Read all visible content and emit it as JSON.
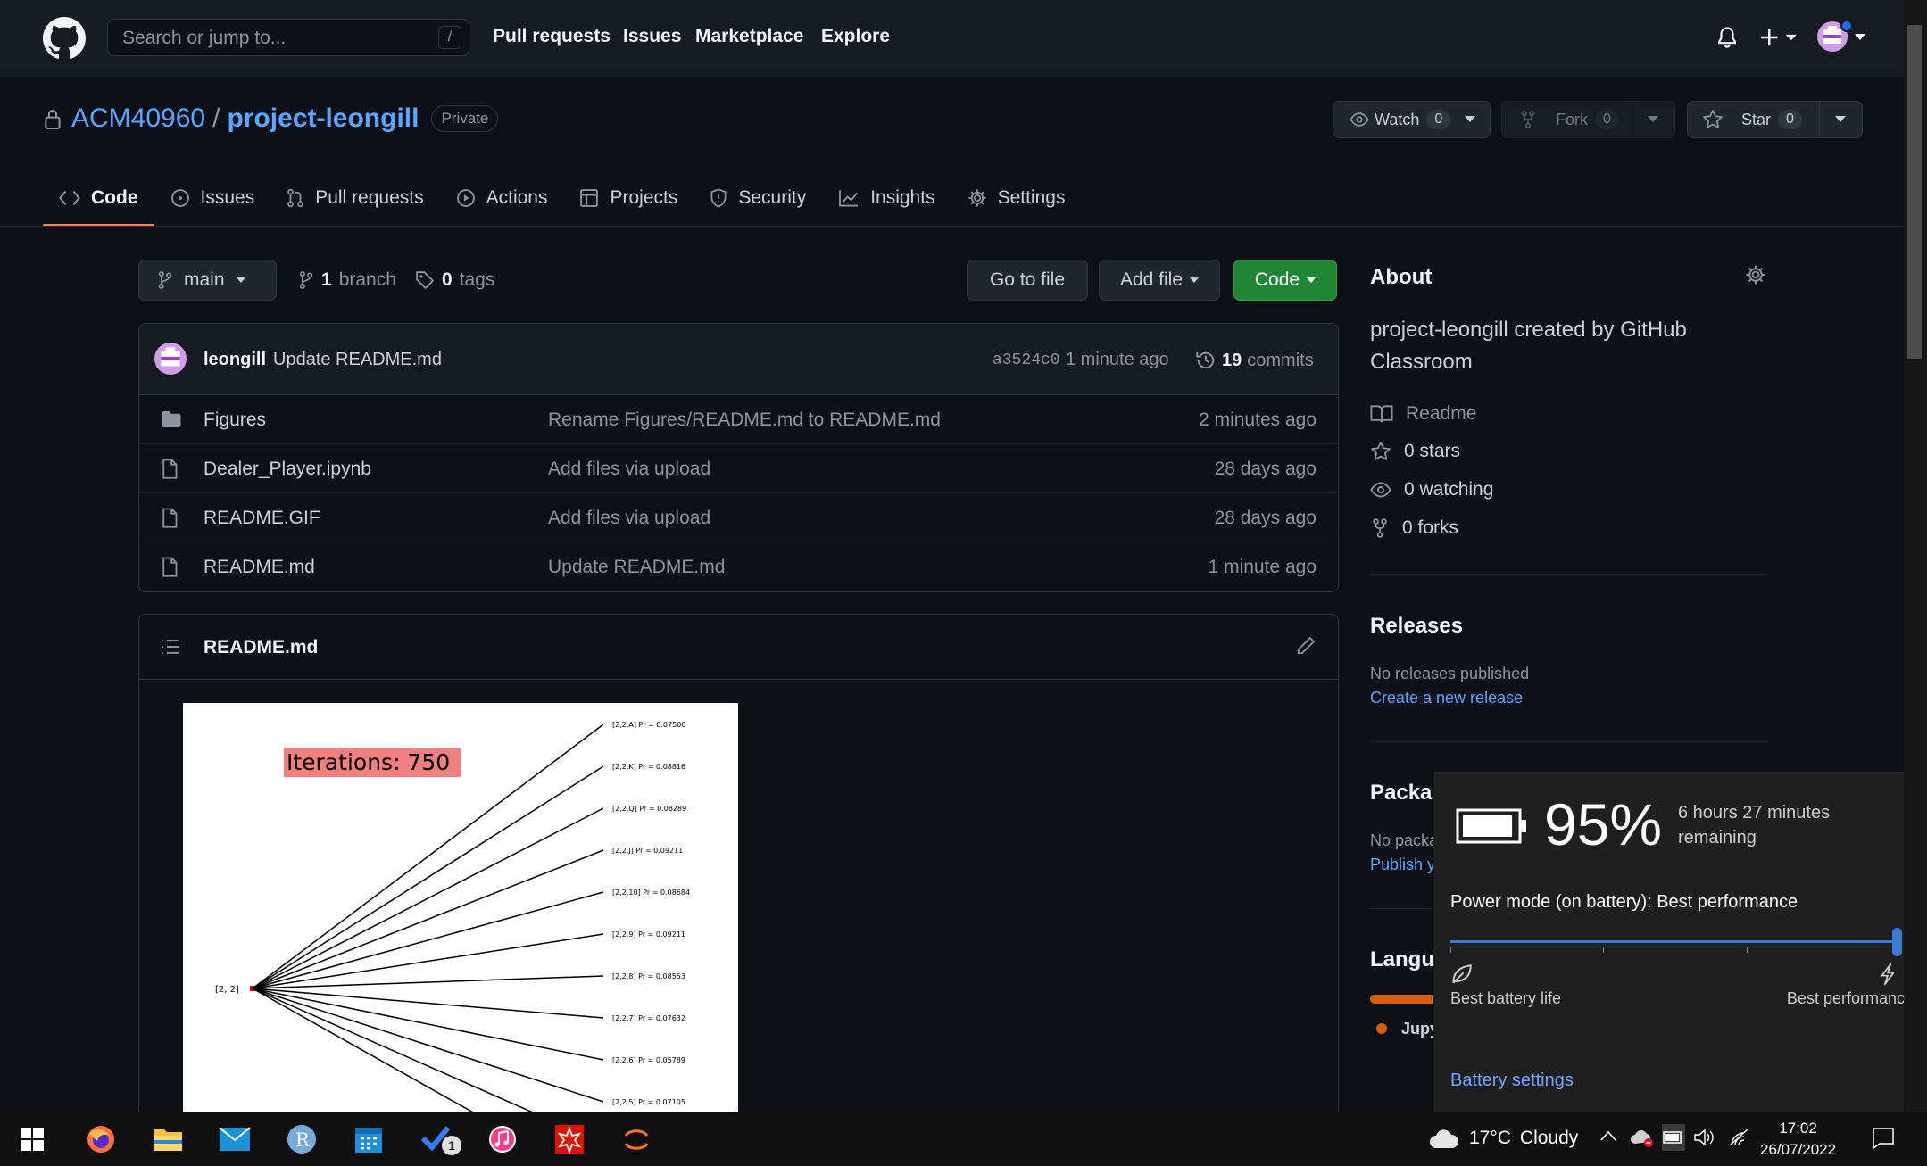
{
  "header": {
    "search_placeholder": "Search or jump to...",
    "search_shortcut": "/",
    "nav": [
      "Pull requests",
      "Issues",
      "Marketplace",
      "Explore"
    ]
  },
  "repo": {
    "owner": "ACM40960",
    "separator": "/",
    "name": "project-leongill",
    "visibility": "Private",
    "watch_label": "Watch",
    "watch_count": "0",
    "fork_label": "Fork",
    "fork_count": "0",
    "star_label": "Star",
    "star_count": "0"
  },
  "tabs": [
    {
      "label": "Code",
      "icon": "code-icon",
      "active": true
    },
    {
      "label": "Issues",
      "icon": "issue-icon"
    },
    {
      "label": "Pull requests",
      "icon": "pull-request-icon"
    },
    {
      "label": "Actions",
      "icon": "play-icon"
    },
    {
      "label": "Projects",
      "icon": "table-icon"
    },
    {
      "label": "Security",
      "icon": "shield-icon"
    },
    {
      "label": "Insights",
      "icon": "graph-icon"
    },
    {
      "label": "Settings",
      "icon": "gear-icon"
    }
  ],
  "branch_bar": {
    "branch": "main",
    "branch_count": "1",
    "branch_word": "branch",
    "tag_count": "0",
    "tag_word": "tags",
    "go_to_file": "Go to file",
    "add_file": "Add file",
    "code": "Code"
  },
  "commit": {
    "author": "leongill",
    "message": "Update README.md",
    "sha": "a3524c0",
    "time": "1 minute ago",
    "count": "19",
    "count_word": "commits"
  },
  "files": [
    {
      "name": "Figures",
      "type": "folder",
      "message": "Rename Figures/README.md to README.md",
      "time": "2 minutes ago"
    },
    {
      "name": "Dealer_Player.ipynb",
      "type": "file",
      "message": "Add files via upload",
      "time": "28 days ago"
    },
    {
      "name": "README.GIF",
      "type": "file",
      "message": "Add files via upload",
      "time": "28 days ago"
    },
    {
      "name": "README.md",
      "type": "file",
      "message": "Update README.md",
      "time": "1 minute ago"
    }
  ],
  "readme": {
    "title": "README.md",
    "figure": {
      "iterations_label": "Iterations: 750",
      "root_label": "[2, 2]",
      "branches": [
        "[2,2,A] Pr = 0.07500",
        "[2,2,K] Pr = 0.08816",
        "[2,2,Q] Pr = 0.08289",
        "[2,2,J] Pr = 0.09211",
        "[2,2,10] Pr = 0.08684",
        "[2,2,9] Pr = 0.09211",
        "[2,2,8] Pr = 0.08553",
        "[2,2,7] Pr = 0.07632",
        "[2,2,6] Pr = 0.05789",
        "[2,2,5] Pr = 0.07105"
      ]
    }
  },
  "sidebar": {
    "about_title": "About",
    "description": "project-leongill created by GitHub Classroom",
    "readme": "Readme",
    "stars": "0 stars",
    "watching": "0 watching",
    "forks": "0 forks",
    "releases_title": "Releases",
    "no_releases": "No releases published",
    "create_release": "Create a new release",
    "packages_title": "Packag",
    "no_packages": "No packa",
    "publish": "Publish y",
    "languages_title": "Langua",
    "language": "Jupy"
  },
  "battery": {
    "percent": "95%",
    "remaining": "6 hours 27 minutes remaining",
    "mode": "Power mode (on battery): Best performance",
    "level": 0.95,
    "mode_level": 1.0,
    "low_label": "Best battery life",
    "high_label": "Best performance",
    "settings_link": "Battery settings"
  },
  "taskbar": {
    "weather_temp": "17°C",
    "weather_desc": "Cloudy",
    "time": "17:02",
    "date": "26/07/2022",
    "todo_badge": "1"
  },
  "colors": {
    "bg": "#0d1117",
    "header_bg": "#161b22",
    "link": "#58a6ff",
    "green_button": "#238636",
    "active_tab": "#f78166",
    "battery_accent": "#3a7bd5"
  }
}
